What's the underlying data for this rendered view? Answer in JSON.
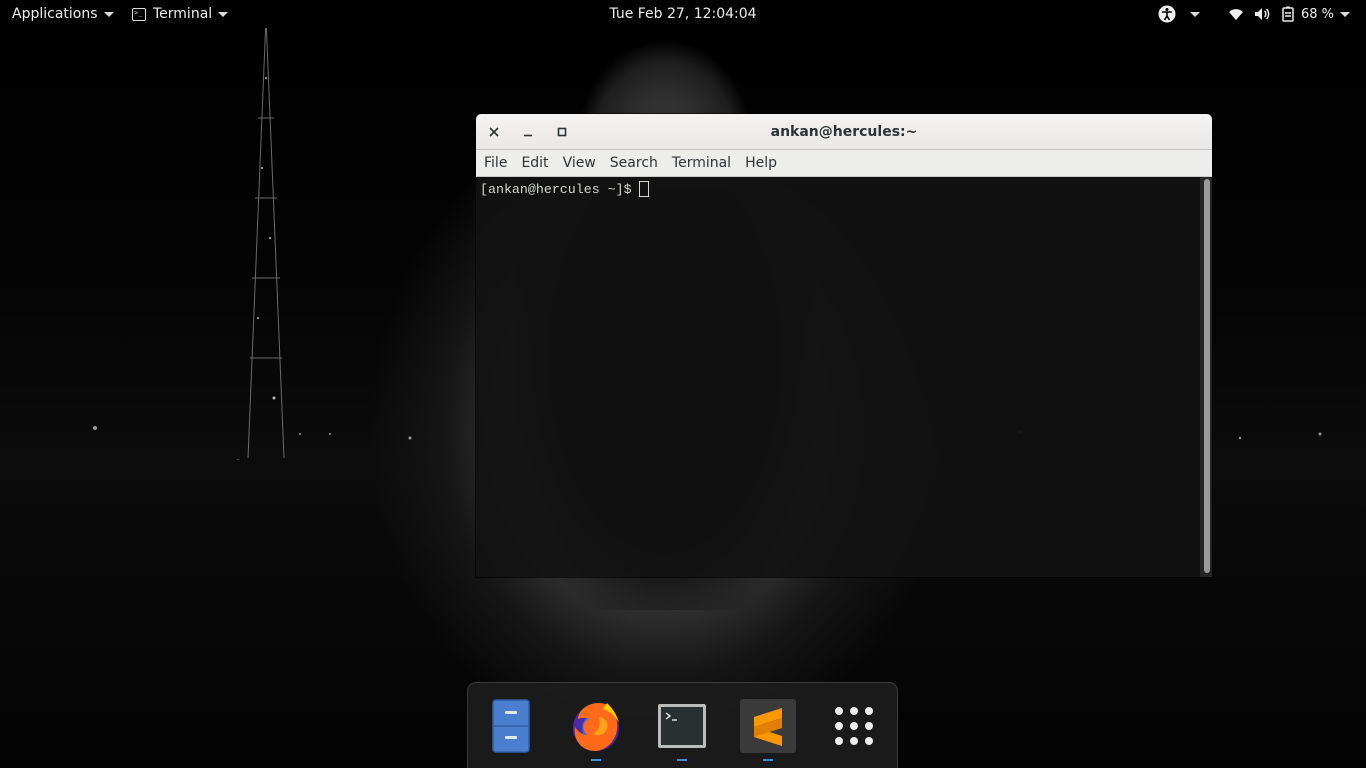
{
  "topbar": {
    "applications_label": "Applications",
    "app_menu_label": "Terminal",
    "clock": "Tue Feb 27, 12:04:04",
    "battery": "68 %",
    "icons": [
      "accessibility-icon",
      "wifi-icon",
      "volume-icon",
      "battery-icon"
    ]
  },
  "window": {
    "title": "ankan@hercules:~",
    "buttons": [
      "close",
      "minimize",
      "maximize"
    ],
    "menu": {
      "file": "File",
      "edit": "Edit",
      "view": "View",
      "search": "Search",
      "terminal": "Terminal",
      "help": "Help"
    },
    "prompt": "[ankan@hercules ~]$"
  },
  "dock": {
    "items": [
      {
        "name": "Files",
        "icon": "file-cabinet-icon",
        "running": false
      },
      {
        "name": "Firefox",
        "icon": "firefox-icon",
        "running": true
      },
      {
        "name": "Terminal",
        "icon": "terminal-icon",
        "running": true
      },
      {
        "name": "Sublime Text",
        "icon": "sublime-icon",
        "running": true
      },
      {
        "name": "Show Applications",
        "icon": "app-grid-icon",
        "running": false
      }
    ]
  },
  "colors": {
    "accent": "#3d8ee6",
    "sublime": "#ff9800",
    "titlebar": "#ededec",
    "terminal_bg": "#121212"
  }
}
